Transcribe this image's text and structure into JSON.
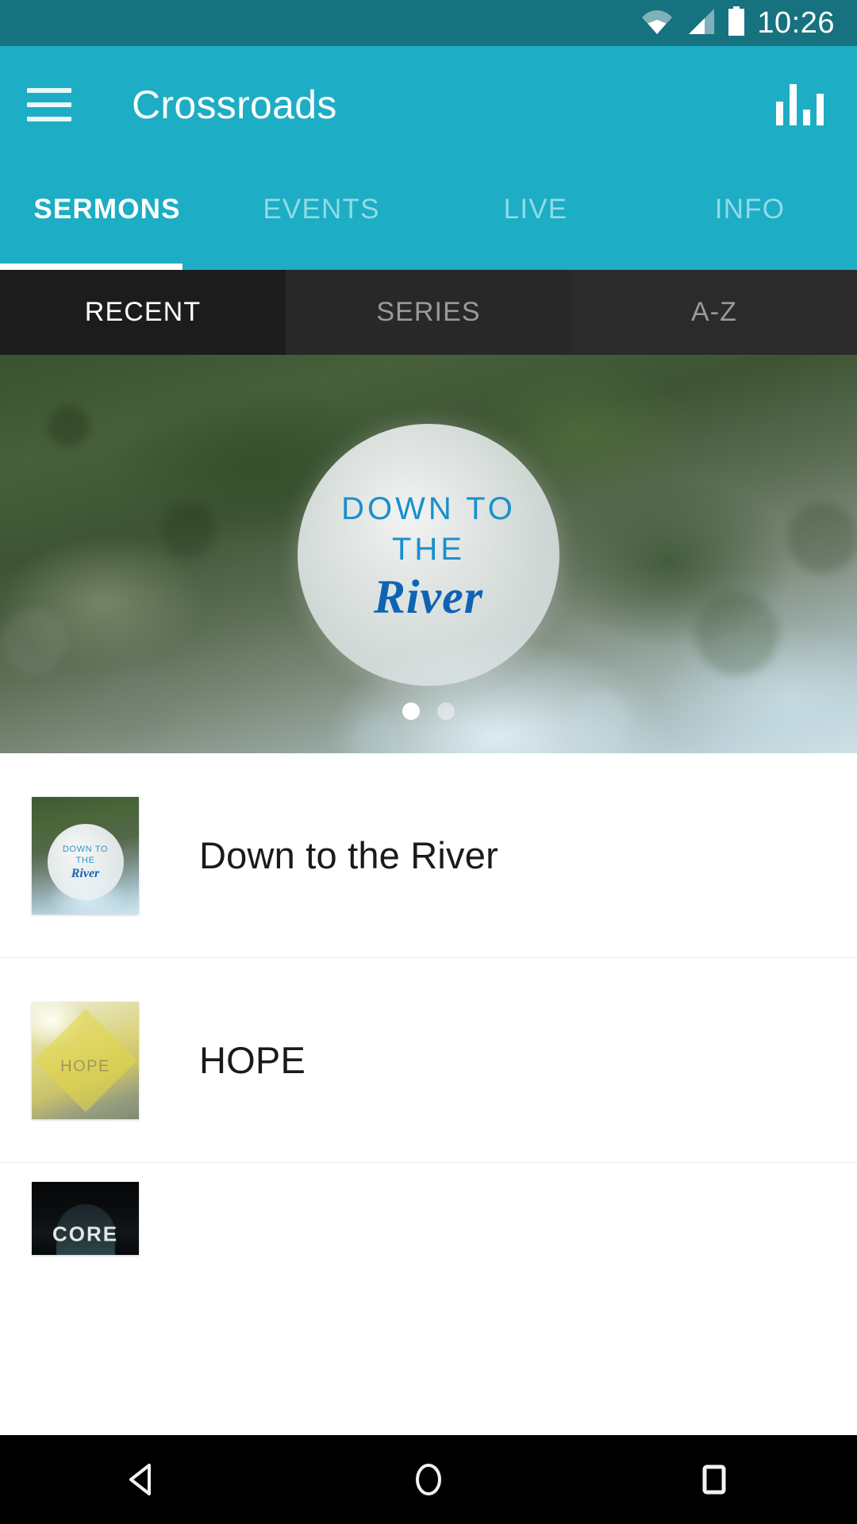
{
  "status_bar": {
    "time": "10:26",
    "icons": [
      "wifi-icon",
      "cellular-signal-icon",
      "battery-icon"
    ],
    "bg_color": "#16727f"
  },
  "app_bar": {
    "menu_icon": "hamburger-menu-icon",
    "title": "Crossroads",
    "action_icon": "equalizer-icon",
    "bg_color": "#1dadc4"
  },
  "tabs": {
    "items": [
      {
        "label": "SERMONS",
        "active": true
      },
      {
        "label": "EVENTS",
        "active": false
      },
      {
        "label": "LIVE",
        "active": false
      },
      {
        "label": "INFO",
        "active": false
      }
    ],
    "active_color": "#ffffff",
    "inactive_color": "#8fdbe8"
  },
  "subtabs": {
    "items": [
      {
        "label": "RECENT",
        "active": true
      },
      {
        "label": "SERIES",
        "active": false
      },
      {
        "label": "A-Z",
        "active": false
      }
    ],
    "active_color": "#ffffff",
    "inactive_color": "#9a9a9a",
    "bg_color": "#1c1c1c"
  },
  "hero": {
    "alt": "river-stream-photo",
    "overlay_line1": "DOWN TO",
    "overlay_line2": "THE",
    "overlay_line3": "River",
    "overlay_text_color": "#1a8fce",
    "script_text_color": "#0f63b4",
    "pagination": {
      "total": 2,
      "active_index": 0
    }
  },
  "list": {
    "items": [
      {
        "title": "Down to the River",
        "thumb": "down-to-the-river-thumbnail",
        "thumb_line1": "DOWN TO",
        "thumb_line2": "THE",
        "thumb_line3": "River"
      },
      {
        "title": "HOPE",
        "thumb": "hope-thumbnail",
        "thumb_label": "HOPE"
      },
      {
        "title": "",
        "thumb": "core-thumbnail",
        "thumb_label": "CORE"
      }
    ]
  },
  "nav_bar": {
    "back": "back-triangle-icon",
    "home": "home-circle-icon",
    "recents": "recents-square-icon",
    "bg_color": "#000000"
  }
}
